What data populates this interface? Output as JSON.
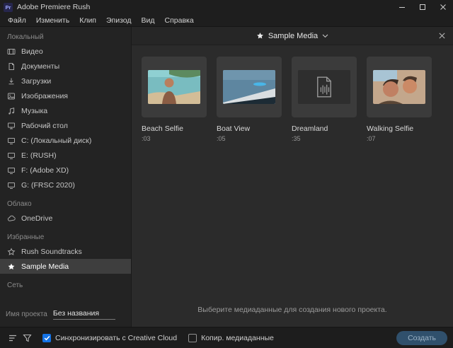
{
  "window": {
    "title": "Adobe Premiere Rush"
  },
  "menu": {
    "items": [
      "Файл",
      "Изменить",
      "Клип",
      "Эпизод",
      "Вид",
      "Справка"
    ]
  },
  "colors": {
    "accent": "#1473e6",
    "selection": "#3e3e3e"
  },
  "sidebar": {
    "headers": {
      "local": "Локальный",
      "cloud": "Облако",
      "favorites": "Избранные",
      "network": "Сеть"
    },
    "local_items": [
      "Видео",
      "Документы",
      "Загрузки",
      "Изображения",
      "Музыка",
      "Рабочий стол",
      "C: (Локальный диск)",
      "E: (RUSH)",
      "F: (Adobe XD)",
      "G: (FRSC 2020)"
    ],
    "cloud_items": [
      "OneDrive"
    ],
    "favorite_items": [
      "Rush Soundtracks",
      "Sample Media"
    ]
  },
  "browser": {
    "title": "Sample Media"
  },
  "media": {
    "items": [
      {
        "name": "Beach Selfie",
        "duration": ":03",
        "type": "video"
      },
      {
        "name": "Boat View",
        "duration": ":05",
        "type": "video"
      },
      {
        "name": "Dreamland",
        "duration": ":35",
        "type": "audio"
      },
      {
        "name": "Walking Selfie",
        "duration": ":07",
        "type": "video"
      }
    ]
  },
  "project": {
    "label": "Имя проекта",
    "value": "Без названия"
  },
  "hint": "Выберите медиаданные для создания нового проекта.",
  "footer": {
    "sync_label": "Синхронизировать с Creative Cloud",
    "copy_label": "Копир. медиаданные",
    "create_label": "Создать"
  }
}
